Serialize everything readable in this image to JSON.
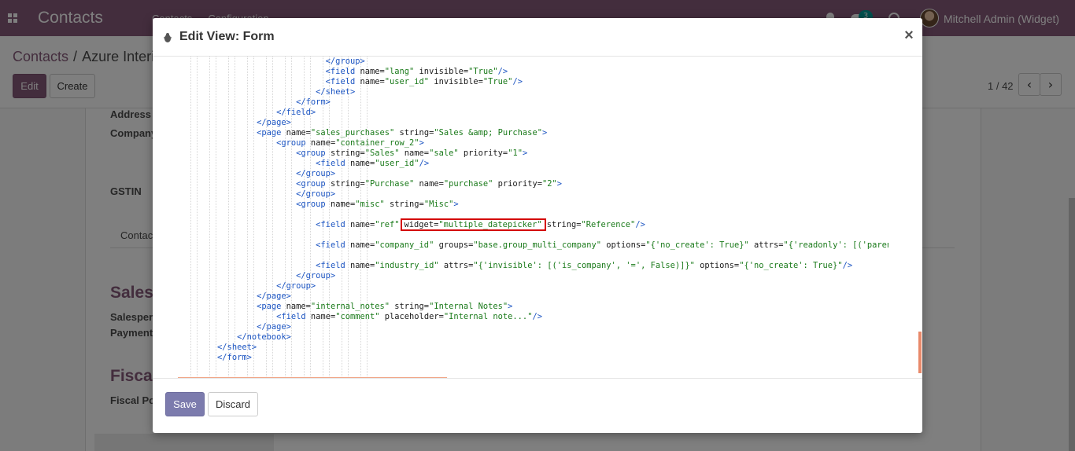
{
  "navbar": {
    "app_name": "Contacts",
    "menu": [
      "Contacts",
      "Configuration"
    ],
    "chat_count": "3",
    "user_name": "Mitchell Admin (Widget)"
  },
  "control_panel": {
    "breadcrumb_root": "Contacts",
    "breadcrumb_sep": "/",
    "breadcrumb_current": "Azure Interior",
    "edit_label": "Edit",
    "create_label": "Create",
    "pager_value": "1 / 42",
    "prev_icon": "‹",
    "next_icon": "›"
  },
  "form_bg": {
    "address_label": "Address",
    "company_label": "Company",
    "gstin_label": "GSTIN",
    "contacts_tab": "Contacts",
    "sales_section": "Sales",
    "salesperson_label": "Salesperson",
    "payment_label": "Payment",
    "fiscal_section": "Fiscal",
    "fiscal_pos_label": "Fiscal Po"
  },
  "modal": {
    "title": "Edit View: Form",
    "close": "×",
    "save_label": "Save",
    "discard_label": "Discard",
    "accent_color": "#7c7bad",
    "highlight_color": "#d40000"
  },
  "code_lines": [
    {
      "indent": 30,
      "parts": [
        [
          "t",
          "</group>"
        ]
      ]
    },
    {
      "indent": 30,
      "parts": [
        [
          "t",
          "<field "
        ],
        [
          "a",
          "name="
        ],
        [
          "v",
          "\"lang\""
        ],
        [
          "a",
          " invisible="
        ],
        [
          "v",
          "\"True\""
        ],
        [
          "t",
          "/>"
        ]
      ]
    },
    {
      "indent": 30,
      "parts": [
        [
          "t",
          "<field "
        ],
        [
          "a",
          "name="
        ],
        [
          "v",
          "\"user_id\""
        ],
        [
          "a",
          " invisible="
        ],
        [
          "v",
          "\"True\""
        ],
        [
          "t",
          "/>"
        ]
      ]
    },
    {
      "indent": 28,
      "parts": [
        [
          "t",
          "</sheet>"
        ]
      ]
    },
    {
      "indent": 24,
      "parts": [
        [
          "t",
          "</form>"
        ]
      ]
    },
    {
      "indent": 20,
      "parts": [
        [
          "t",
          "</field>"
        ]
      ]
    },
    {
      "indent": 16,
      "parts": [
        [
          "t",
          "</page>"
        ]
      ]
    },
    {
      "indent": 16,
      "parts": [
        [
          "t",
          "<page "
        ],
        [
          "a",
          "name="
        ],
        [
          "v",
          "\"sales_purchases\""
        ],
        [
          "a",
          " string="
        ],
        [
          "v",
          "\"Sales &amp; Purchase\""
        ],
        [
          "t",
          ">"
        ]
      ]
    },
    {
      "indent": 20,
      "parts": [
        [
          "t",
          "<group "
        ],
        [
          "a",
          "name="
        ],
        [
          "v",
          "\"container_row_2\""
        ],
        [
          "t",
          ">"
        ]
      ]
    },
    {
      "indent": 24,
      "parts": [
        [
          "t",
          "<group "
        ],
        [
          "a",
          "string="
        ],
        [
          "v",
          "\"Sales\""
        ],
        [
          "a",
          " name="
        ],
        [
          "v",
          "\"sale\""
        ],
        [
          "a",
          " priority="
        ],
        [
          "v",
          "\"1\""
        ],
        [
          "t",
          ">"
        ]
      ]
    },
    {
      "indent": 28,
      "parts": [
        [
          "t",
          "<field "
        ],
        [
          "a",
          "name="
        ],
        [
          "v",
          "\"user_id\""
        ],
        [
          "t",
          "/>"
        ]
      ]
    },
    {
      "indent": 24,
      "parts": [
        [
          "t",
          "</group>"
        ]
      ]
    },
    {
      "indent": 24,
      "parts": [
        [
          "t",
          "<group "
        ],
        [
          "a",
          "string="
        ],
        [
          "v",
          "\"Purchase\""
        ],
        [
          "a",
          " name="
        ],
        [
          "v",
          "\"purchase\""
        ],
        [
          "a",
          " priority="
        ],
        [
          "v",
          "\"2\""
        ],
        [
          "t",
          ">"
        ]
      ]
    },
    {
      "indent": 24,
      "parts": [
        [
          "t",
          "</group>"
        ]
      ]
    },
    {
      "indent": 24,
      "parts": [
        [
          "t",
          "<group "
        ],
        [
          "a",
          "name="
        ],
        [
          "v",
          "\"misc\""
        ],
        [
          "a",
          " string="
        ],
        [
          "v",
          "\"Misc\""
        ],
        [
          "t",
          ">"
        ]
      ]
    },
    {
      "indent": 0,
      "parts": []
    },
    {
      "indent": 28,
      "parts": [
        [
          "t",
          "<field "
        ],
        [
          "a",
          "name="
        ],
        [
          "v",
          "\"ref\""
        ],
        [
          "ha",
          "widget="
        ],
        [
          "hv",
          "\"multiple_datepicker\""
        ],
        [
          "a",
          "string="
        ],
        [
          "v",
          "\"Reference\""
        ],
        [
          "t",
          "/>"
        ]
      ]
    },
    {
      "indent": 0,
      "parts": []
    },
    {
      "indent": 28,
      "parts": [
        [
          "t",
          "<field "
        ],
        [
          "a",
          "name="
        ],
        [
          "v",
          "\"company_id\""
        ],
        [
          "a",
          " groups="
        ],
        [
          "v",
          "\"base.group_multi_company\""
        ],
        [
          "a",
          " options="
        ],
        [
          "v",
          "\"{'no_create': True}\""
        ],
        [
          "a",
          " attrs="
        ],
        [
          "v",
          "\"{'readonly': [('parent_id', '!=', False)]}\""
        ],
        [
          "t",
          "/>"
        ]
      ]
    },
    {
      "indent": 0,
      "parts": []
    },
    {
      "indent": 28,
      "parts": [
        [
          "t",
          "<field "
        ],
        [
          "a",
          "name="
        ],
        [
          "v",
          "\"industry_id\""
        ],
        [
          "a",
          " attrs="
        ],
        [
          "v",
          "\"{'invisible': [('is_company', '=', False)]}\""
        ],
        [
          "a",
          " options="
        ],
        [
          "v",
          "\"{'no_create': True}\""
        ],
        [
          "t",
          "/>"
        ]
      ]
    },
    {
      "indent": 24,
      "parts": [
        [
          "t",
          "</group>"
        ]
      ]
    },
    {
      "indent": 20,
      "parts": [
        [
          "t",
          "</group>"
        ]
      ]
    },
    {
      "indent": 16,
      "parts": [
        [
          "t",
          "</page>"
        ]
      ]
    },
    {
      "indent": 16,
      "parts": [
        [
          "t",
          "<page "
        ],
        [
          "a",
          "name="
        ],
        [
          "v",
          "\"internal_notes\""
        ],
        [
          "a",
          " string="
        ],
        [
          "v",
          "\"Internal Notes\""
        ],
        [
          "t",
          ">"
        ]
      ]
    },
    {
      "indent": 20,
      "parts": [
        [
          "t",
          "<field "
        ],
        [
          "a",
          "name="
        ],
        [
          "v",
          "\"comment\""
        ],
        [
          "a",
          " placeholder="
        ],
        [
          "v",
          "\"Internal note...\""
        ],
        [
          "t",
          "/>"
        ]
      ]
    },
    {
      "indent": 16,
      "parts": [
        [
          "t",
          "</page>"
        ]
      ]
    },
    {
      "indent": 12,
      "parts": [
        [
          "t",
          "</notebook>"
        ]
      ]
    },
    {
      "indent": 8,
      "parts": [
        [
          "t",
          "</sheet>"
        ]
      ]
    },
    {
      "indent": 8,
      "parts": [
        [
          "t",
          "</form>"
        ]
      ]
    },
    {
      "indent": 0,
      "parts": []
    }
  ]
}
